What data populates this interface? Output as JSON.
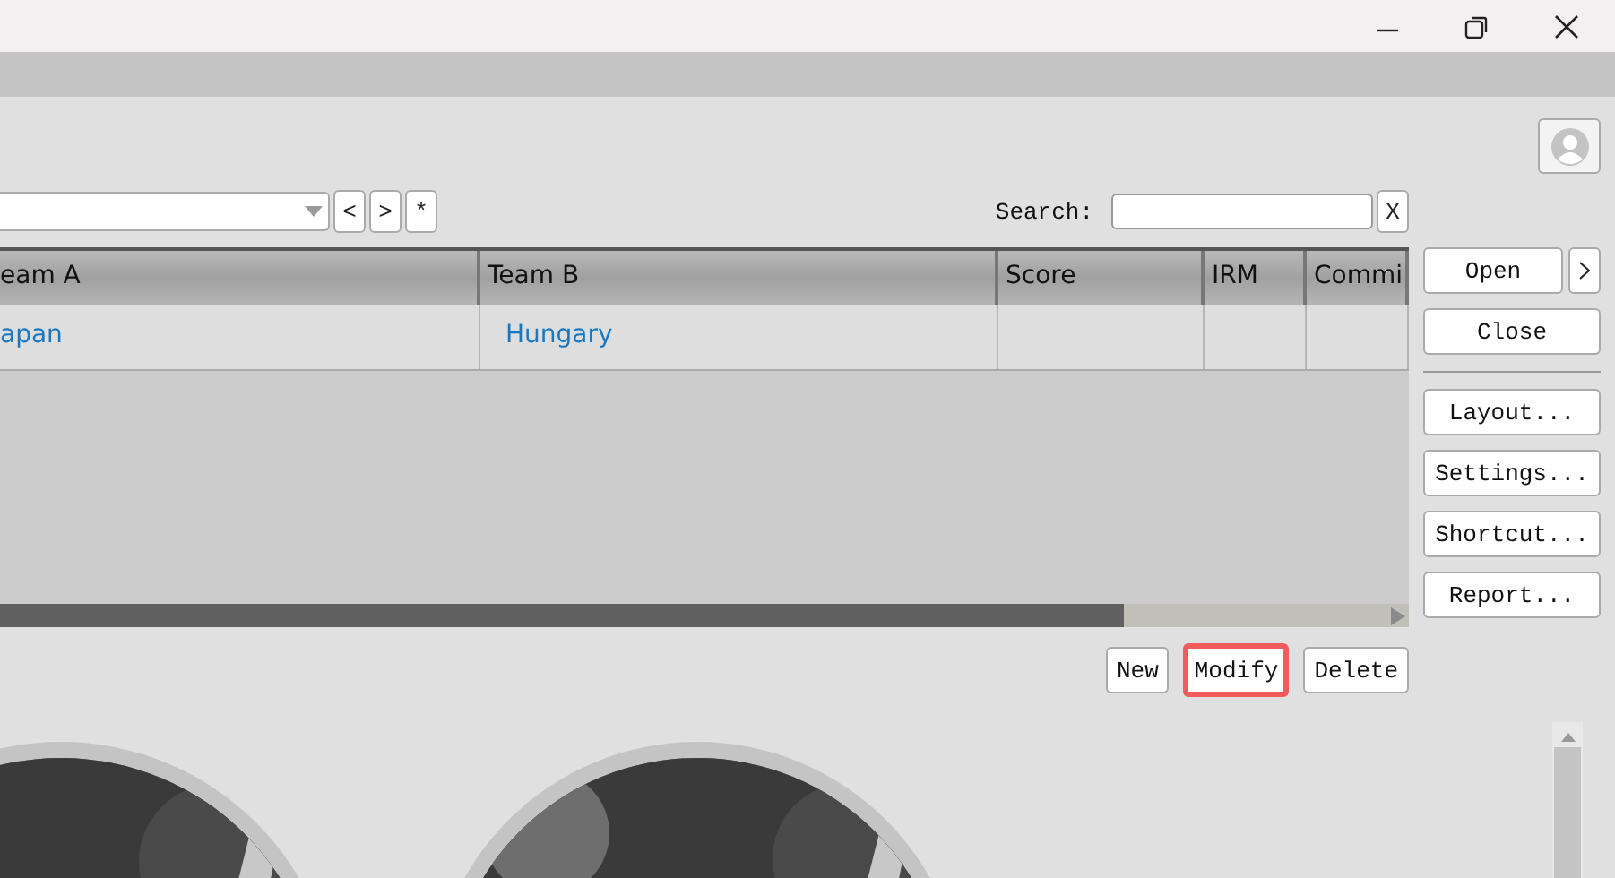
{
  "toolbar": {
    "nav_buttons": [
      "<",
      ">",
      "*"
    ],
    "search_label": "Search:",
    "clear_button": "X"
  },
  "table": {
    "columns": [
      "eam A",
      "Team B",
      "Score",
      "IRM",
      "Commi"
    ],
    "rows": [
      {
        "cells": [
          "apan",
          "Hungary",
          "",
          "",
          ""
        ]
      }
    ],
    "scroll": {
      "level": 0.81
    }
  },
  "actions": [
    {
      "label": "New",
      "highlighted": false
    },
    {
      "label": "Modify",
      "highlighted": true
    },
    {
      "label": "Delete",
      "highlighted": false
    }
  ],
  "sidebar": {
    "groups": [
      [
        {
          "label": "Open",
          "menu": true
        },
        {
          "label": "Close",
          "menu": false
        }
      ],
      [
        {
          "label": "Layout...",
          "menu": false
        },
        {
          "label": "Settings...",
          "menu": false
        },
        {
          "label": "Shortcut...",
          "menu": false
        },
        {
          "label": "Report...",
          "menu": false
        }
      ]
    ]
  }
}
